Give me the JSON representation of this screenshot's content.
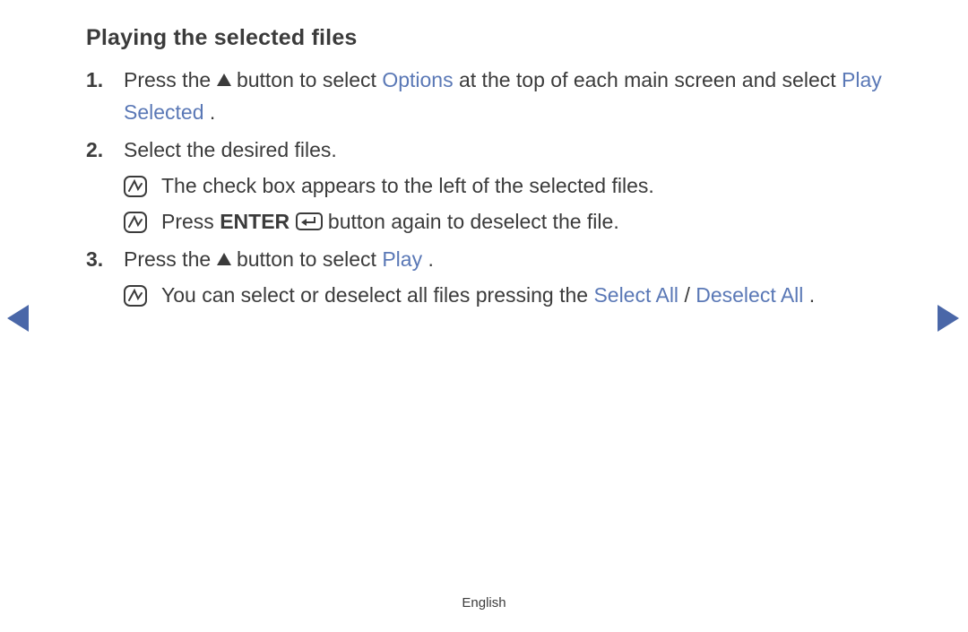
{
  "title": "Playing the selected files",
  "steps": {
    "s1": {
      "pre": "Press the ",
      "mid": " button to select ",
      "options": "Options",
      "mid2": " at the top of each main screen and select ",
      "playSelected": "Play Selected",
      "post": "."
    },
    "s2": {
      "text": "Select the desired files.",
      "note1": "The check box appears to the left of the selected files.",
      "note2a": "Press ",
      "enter": "ENTER",
      "note2b": " button again to deselect the file."
    },
    "s3": {
      "pre": "Press the ",
      "mid": " button to select ",
      "play": "Play",
      "post": ".",
      "note_a": "You can select or deselect all files pressing the ",
      "selectAll": "Select All",
      "sep": " / ",
      "deselectAll": "Deselect All",
      "note_end": "."
    }
  },
  "footer": "English"
}
